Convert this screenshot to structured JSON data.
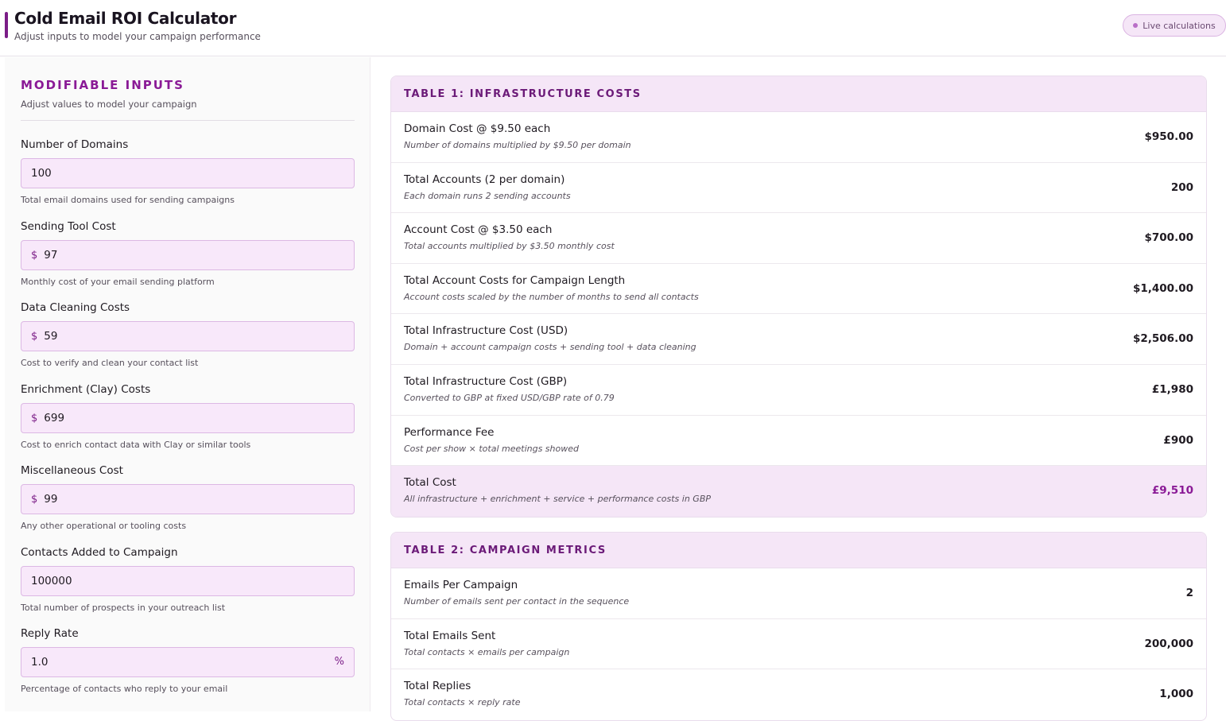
{
  "header": {
    "title": "Cold Email ROI Calculator",
    "subtitle": "Adjust inputs to model your campaign performance",
    "badge": "Live calculations"
  },
  "sidebar": {
    "heading": "MODIFIABLE INPUTS",
    "subheading": "Adjust values to model your campaign",
    "fields": [
      {
        "label": "Number of Domains",
        "value": "100",
        "prefix": "",
        "suffix": "",
        "help": "Total email domains used for sending campaigns"
      },
      {
        "label": "Sending Tool Cost",
        "value": "97",
        "prefix": "$",
        "suffix": "",
        "help": "Monthly cost of your email sending platform"
      },
      {
        "label": "Data Cleaning Costs",
        "value": "59",
        "prefix": "$",
        "suffix": "",
        "help": "Cost to verify and clean your contact list"
      },
      {
        "label": "Enrichment (Clay) Costs",
        "value": "699",
        "prefix": "$",
        "suffix": "",
        "help": "Cost to enrich contact data with Clay or similar tools"
      },
      {
        "label": "Miscellaneous Cost",
        "value": "99",
        "prefix": "$",
        "suffix": "",
        "help": "Any other operational or tooling costs"
      },
      {
        "label": "Contacts Added to Campaign",
        "value": "100000",
        "prefix": "",
        "suffix": "",
        "help": "Total number of prospects in your outreach list"
      },
      {
        "label": "Reply Rate",
        "value": "1.0",
        "prefix": "",
        "suffix": "%",
        "help": "Percentage of contacts who reply to your email"
      }
    ]
  },
  "table1": {
    "title": "TABLE 1: INFRASTRUCTURE COSTS",
    "rows": [
      {
        "label": "Domain Cost @ $9.50 each",
        "desc": "Number of domains multiplied by $9.50 per domain",
        "value": "$950.00"
      },
      {
        "label": "Total Accounts (2 per domain)",
        "desc": "Each domain runs 2 sending accounts",
        "value": "200"
      },
      {
        "label": "Account Cost @ $3.50 each",
        "desc": "Total accounts multiplied by $3.50 monthly cost",
        "value": "$700.00"
      },
      {
        "label": "Total Account Costs for Campaign Length",
        "desc": "Account costs scaled by the number of months to send all contacts",
        "value": "$1,400.00"
      },
      {
        "label": "Total Infrastructure Cost (USD)",
        "desc": "Domain + account campaign costs + sending tool + data cleaning",
        "value": "$2,506.00"
      },
      {
        "label": "Total Infrastructure Cost (GBP)",
        "desc": "Converted to GBP at fixed USD/GBP rate of 0.79",
        "value": "£1,980"
      },
      {
        "label": "Performance Fee",
        "desc": "Cost per show × total meetings showed",
        "value": "£900"
      },
      {
        "label": "Total Cost",
        "desc": "All infrastructure + enrichment + service + performance costs in GBP",
        "value": "£9,510"
      }
    ]
  },
  "table2": {
    "title": "TABLE 2: CAMPAIGN METRICS",
    "rows": [
      {
        "label": "Emails Per Campaign",
        "desc": "Number of emails sent per contact in the sequence",
        "value": "2"
      },
      {
        "label": "Total Emails Sent",
        "desc": "Total contacts × emails per campaign",
        "value": "200,000"
      },
      {
        "label": "Total Replies",
        "desc": "Total contacts × reply rate",
        "value": "1,000"
      }
    ]
  },
  "colors": {
    "accent": "#8a1a96",
    "input_bg": "#f8e8fa",
    "table_header_bg": "#f5e6f7"
  }
}
